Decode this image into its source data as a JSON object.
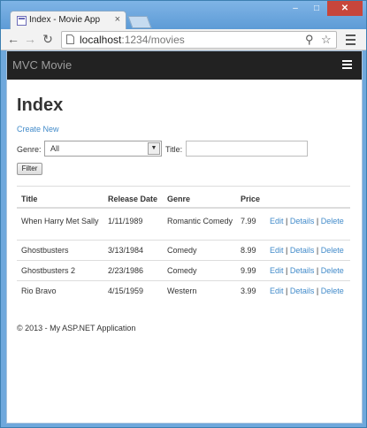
{
  "browser": {
    "tab_title": "Index - Movie App",
    "url_host": "localhost",
    "url_path": ":1234/movies"
  },
  "navbar": {
    "brand": "MVC Movie"
  },
  "page": {
    "title": "Index",
    "create_link": "Create New",
    "genre_label": "Genre:",
    "genre_selected": "All",
    "title_label": "Title:",
    "title_value": "",
    "filter_button": "Filter"
  },
  "table": {
    "headers": [
      "Title",
      "Release Date",
      "Genre",
      "Price"
    ],
    "rows": [
      {
        "title": "When Harry Met Sally",
        "date": "1/11/1989",
        "genre": "Romantic Comedy",
        "price": "7.99"
      },
      {
        "title": "Ghostbusters",
        "date": "3/13/1984",
        "genre": "Comedy",
        "price": "8.99"
      },
      {
        "title": "Ghostbusters 2",
        "date": "2/23/1986",
        "genre": "Comedy",
        "price": "9.99"
      },
      {
        "title": "Rio Bravo",
        "date": "4/15/1959",
        "genre": "Western",
        "price": "3.99"
      }
    ],
    "actions": {
      "edit": "Edit",
      "details": "Details",
      "delete": "Delete",
      "separator": "|"
    }
  },
  "footer": "© 2013 - My ASP.NET Application"
}
